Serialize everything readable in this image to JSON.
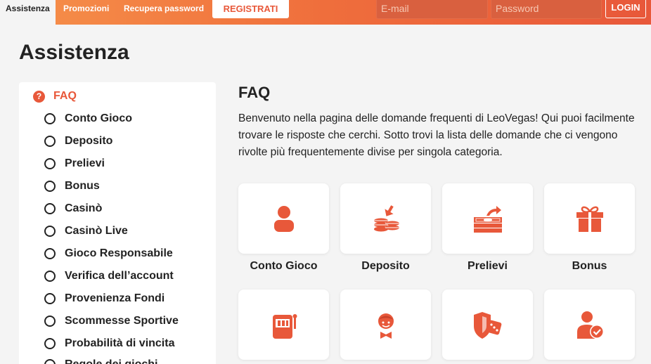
{
  "header": {
    "tabs": [
      "Assistenza",
      "Promozioni",
      "Recupera password"
    ],
    "register_label": "REGISTRATI",
    "email_placeholder": "E-mail",
    "password_placeholder": "Password",
    "login_label": "LOGIN"
  },
  "page_title": "Assistenza",
  "sidebar": {
    "heading": "FAQ",
    "heading_icon": "?",
    "items": [
      "Conto Gioco",
      "Deposito",
      "Prelievi",
      "Bonus",
      "Casinò",
      "Casinò Live",
      "Gioco Responsabile",
      "Verifica dell’account",
      "Provenienza Fondi",
      "Scommesse Sportive",
      "Probabilità di vincita",
      "Regole dei giochi"
    ]
  },
  "main": {
    "title": "FAQ",
    "intro": "Benvenuto nella pagina delle domande frequenti di LeoVegas! Qui puoi facilmente trovare le risposte che cerchi. Sotto trovi la lista delle domande che ci vengono rivolte più frequentemente divise per singola categoria.",
    "cards": [
      {
        "label": "Conto Gioco",
        "icon": "user-icon"
      },
      {
        "label": "Deposito",
        "icon": "coins-deposit-icon"
      },
      {
        "label": "Prelievi",
        "icon": "cash-withdraw-icon"
      },
      {
        "label": "Bonus",
        "icon": "gift-icon"
      },
      {
        "label": "",
        "icon": "slot-machine-icon"
      },
      {
        "label": "",
        "icon": "croupier-icon"
      },
      {
        "label": "",
        "icon": "shield-dice-icon"
      },
      {
        "label": "",
        "icon": "user-verified-icon"
      }
    ]
  },
  "colors": {
    "accent": "#e8583a",
    "bar_start": "#f6914a",
    "background": "#f4f4f4"
  }
}
